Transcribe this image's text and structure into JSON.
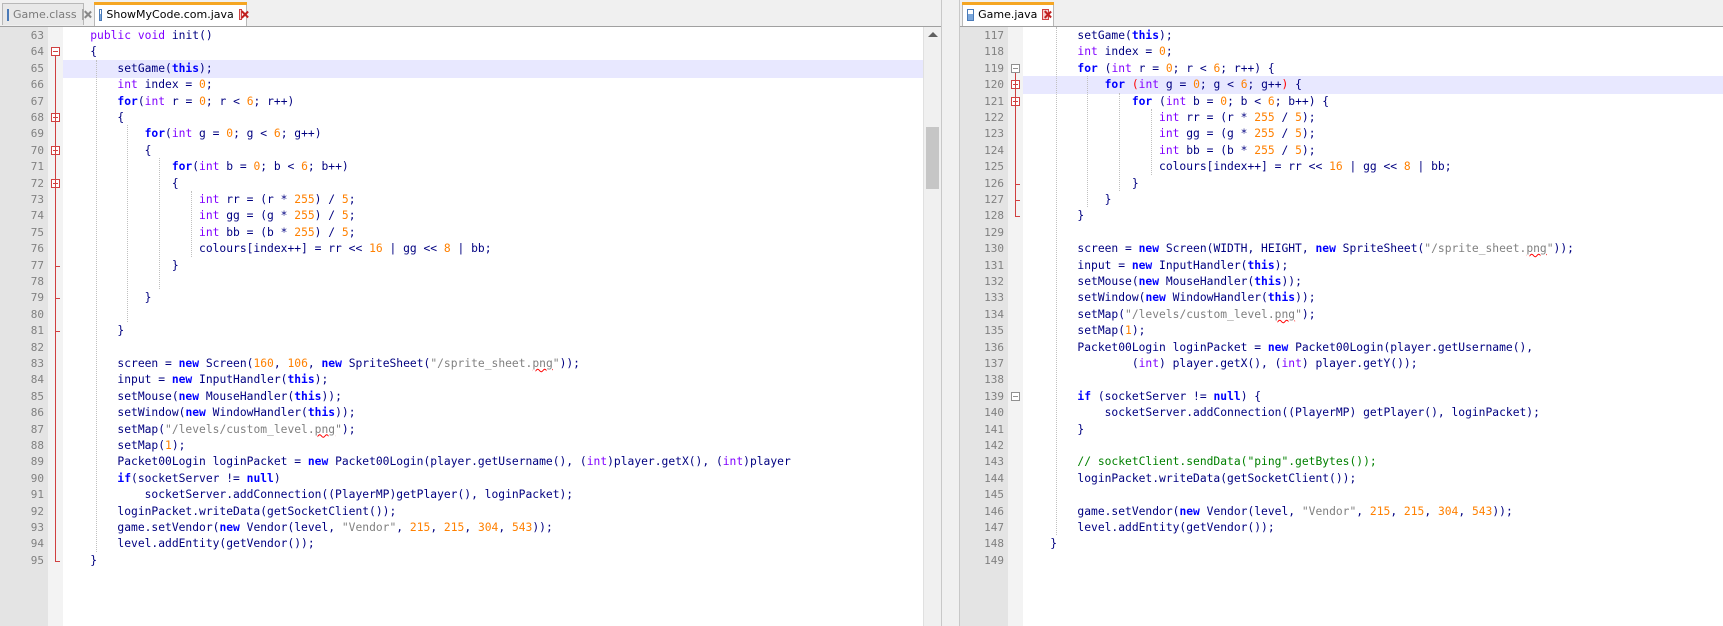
{
  "left_tabs": [
    {
      "label": "Game.class",
      "active": false
    },
    {
      "label": "ShowMyCode.com.java",
      "active": true
    }
  ],
  "right_tabs": [
    {
      "label": "Game.java",
      "active": true
    }
  ],
  "left_lines": [
    {
      "n": "63",
      "t": "    public void init()"
    },
    {
      "n": "64",
      "t": "    {"
    },
    {
      "n": "65",
      "t": "        setGame(this);"
    },
    {
      "n": "66",
      "t": "        int index = 0;"
    },
    {
      "n": "67",
      "t": "        for(int r = 0; r < 6; r++)"
    },
    {
      "n": "68",
      "t": "        {"
    },
    {
      "n": "69",
      "t": "            for(int g = 0; g < 6; g++)"
    },
    {
      "n": "70",
      "t": "            {"
    },
    {
      "n": "71",
      "t": "                for(int b = 0; b < 6; b++)"
    },
    {
      "n": "72",
      "t": "                {"
    },
    {
      "n": "73",
      "t": "                    int rr = (r * 255) / 5;"
    },
    {
      "n": "74",
      "t": "                    int gg = (g * 255) / 5;"
    },
    {
      "n": "75",
      "t": "                    int bb = (b * 255) / 5;"
    },
    {
      "n": "76",
      "t": "                    colours[index++] = rr << 16 | gg << 8 | bb;"
    },
    {
      "n": "77",
      "t": "                }"
    },
    {
      "n": "78",
      "t": ""
    },
    {
      "n": "79",
      "t": "            }"
    },
    {
      "n": "80",
      "t": ""
    },
    {
      "n": "81",
      "t": "        }"
    },
    {
      "n": "82",
      "t": ""
    },
    {
      "n": "83",
      "t": "        screen = new Screen(160, 106, new SpriteSheet(\"/sprite_sheet.png\"));"
    },
    {
      "n": "84",
      "t": "        input = new InputHandler(this);"
    },
    {
      "n": "85",
      "t": "        setMouse(new MouseHandler(this));"
    },
    {
      "n": "86",
      "t": "        setWindow(new WindowHandler(this));"
    },
    {
      "n": "87",
      "t": "        setMap(\"/levels/custom_level.png\");"
    },
    {
      "n": "88",
      "t": "        setMap(1);"
    },
    {
      "n": "89",
      "t": "        Packet00Login loginPacket = new Packet00Login(player.getUsername(), (int)player.getX(), (int)player"
    },
    {
      "n": "90",
      "t": "        if(socketServer != null)"
    },
    {
      "n": "91",
      "t": "            socketServer.addConnection((PlayerMP)getPlayer(), loginPacket);"
    },
    {
      "n": "92",
      "t": "        loginPacket.writeData(getSocketClient());"
    },
    {
      "n": "93",
      "t": "        game.setVendor(new Vendor(level, \"Vendor\", 215, 215, 304, 543));"
    },
    {
      "n": "94",
      "t": "        level.addEntity(getVendor());"
    },
    {
      "n": "95",
      "t": "    }"
    }
  ],
  "right_lines": [
    {
      "n": "117",
      "t": "        setGame(this);"
    },
    {
      "n": "118",
      "t": "        int index = 0;"
    },
    {
      "n": "119",
      "t": "        for (int r = 0; r < 6; r++) {"
    },
    {
      "n": "120",
      "t": "            for (int g = 0; g < 6; g++) {"
    },
    {
      "n": "121",
      "t": "                for (int b = 0; b < 6; b++) {"
    },
    {
      "n": "122",
      "t": "                    int rr = (r * 255 / 5);"
    },
    {
      "n": "123",
      "t": "                    int gg = (g * 255 / 5);"
    },
    {
      "n": "124",
      "t": "                    int bb = (b * 255 / 5);"
    },
    {
      "n": "125",
      "t": "                    colours[index++] = rr << 16 | gg << 8 | bb;"
    },
    {
      "n": "126",
      "t": "                }"
    },
    {
      "n": "127",
      "t": "            }"
    },
    {
      "n": "128",
      "t": "        }"
    },
    {
      "n": "129",
      "t": ""
    },
    {
      "n": "130",
      "t": "        screen = new Screen(WIDTH, HEIGHT, new SpriteSheet(\"/sprite_sheet.png\"));"
    },
    {
      "n": "131",
      "t": "        input = new InputHandler(this);"
    },
    {
      "n": "132",
      "t": "        setMouse(new MouseHandler(this));"
    },
    {
      "n": "133",
      "t": "        setWindow(new WindowHandler(this));"
    },
    {
      "n": "134",
      "t": "        setMap(\"/levels/custom_level.png\");"
    },
    {
      "n": "135",
      "t": "        setMap(1);"
    },
    {
      "n": "136",
      "t": "        Packet00Login loginPacket = new Packet00Login(player.getUsername(),"
    },
    {
      "n": "137",
      "t": "                (int) player.getX(), (int) player.getY());"
    },
    {
      "n": "138",
      "t": ""
    },
    {
      "n": "139",
      "t": "        if (socketServer != null) {"
    },
    {
      "n": "140",
      "t": "            socketServer.addConnection((PlayerMP) getPlayer(), loginPacket);"
    },
    {
      "n": "141",
      "t": "        }"
    },
    {
      "n": "142",
      "t": ""
    },
    {
      "n": "143",
      "t": "        // socketClient.sendData(\"ping\".getBytes());"
    },
    {
      "n": "144",
      "t": "        loginPacket.writeData(getSocketClient());"
    },
    {
      "n": "145",
      "t": ""
    },
    {
      "n": "146",
      "t": "        game.setVendor(new Vendor(level, \"Vendor\", 215, 215, 304, 543));"
    },
    {
      "n": "147",
      "t": "        level.addEntity(getVendor());"
    },
    {
      "n": "148",
      "t": "    }"
    },
    {
      "n": "149",
      "t": ""
    }
  ],
  "colors": {
    "keyword": "#8000ff",
    "keyword_bold": "#0000ff",
    "number": "#ff8000",
    "string": "#808080",
    "comment": "#008000",
    "operator": "#000080",
    "current_line": "#e8e8ff",
    "fold_marker": "#d04040",
    "active_tab_accent": "#f5a623"
  }
}
